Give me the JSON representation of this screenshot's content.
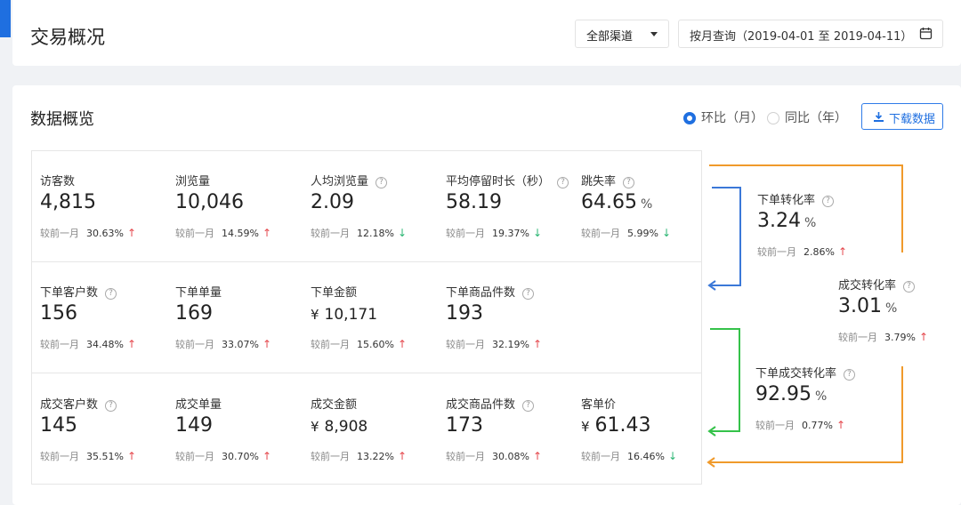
{
  "colors": {
    "accent": "#1f6fe0",
    "up": "#e5484d",
    "down": "#2bb673",
    "flow_blue": "#3b78d8",
    "flow_green": "#35c24a",
    "flow_orange": "#f09a2b"
  },
  "header": {
    "title": "交易概况",
    "channel_select": "全部渠道",
    "date_range": "按月查询（2019-04-01 至 2019-04-11）",
    "calendar_icon": "calendar-icon"
  },
  "overview": {
    "title": "数据概览",
    "radio_mom": "环比（月）",
    "radio_yoy": "同比（年）",
    "download_label": "下载数据",
    "compare_label": "较前一月",
    "help_glyph": "?",
    "up_glyph": "↑",
    "down_glyph": "↓",
    "currency": "¥"
  },
  "metrics": {
    "visitors": {
      "name": "访客数",
      "value": "4,815",
      "pct": "30.63%",
      "trend": "up"
    },
    "pageviews": {
      "name": "浏览量",
      "value": "10,046",
      "pct": "14.59%",
      "trend": "up"
    },
    "pv_per_user": {
      "name": "人均浏览量",
      "value": "2.09",
      "pct": "12.18%",
      "trend": "down"
    },
    "avg_stay": {
      "name": "平均停留时长（秒）",
      "value": "58.19",
      "pct": "19.37%",
      "trend": "down"
    },
    "bounce_rate": {
      "name": "跳失率",
      "value": "64.65",
      "unit": "%",
      "pct": "5.99%",
      "trend": "down"
    },
    "order_customers": {
      "name": "下单客户数",
      "value": "156",
      "pct": "34.48%",
      "trend": "up"
    },
    "order_count": {
      "name": "下单单量",
      "value": "169",
      "pct": "33.07%",
      "trend": "up"
    },
    "order_amount": {
      "name": "下单金额",
      "value": "10,171",
      "pct": "15.60%",
      "trend": "up"
    },
    "order_items": {
      "name": "下单商品件数",
      "value": "193",
      "pct": "32.19%",
      "trend": "up"
    },
    "deal_customers": {
      "name": "成交客户数",
      "value": "145",
      "pct": "35.51%",
      "trend": "up"
    },
    "deal_count": {
      "name": "成交单量",
      "value": "149",
      "pct": "30.70%",
      "trend": "up"
    },
    "deal_amount": {
      "name": "成交金额",
      "value": "8,908",
      "pct": "13.22%",
      "trend": "up"
    },
    "deal_items": {
      "name": "成交商品件数",
      "value": "173",
      "pct": "30.08%",
      "trend": "up"
    },
    "avg_order_value": {
      "name": "客单价",
      "value": "61.43",
      "pct": "16.46%",
      "trend": "down"
    },
    "order_conversion": {
      "name": "下单转化率",
      "value": "3.24",
      "unit": "%",
      "pct": "2.86%",
      "trend": "up"
    },
    "deal_conversion": {
      "name": "成交转化率",
      "value": "3.01",
      "unit": "%",
      "pct": "3.79%",
      "trend": "up"
    },
    "order_deal_conversion": {
      "name": "下单成交转化率",
      "value": "92.95",
      "unit": "%",
      "pct": "0.77%",
      "trend": "up"
    }
  }
}
